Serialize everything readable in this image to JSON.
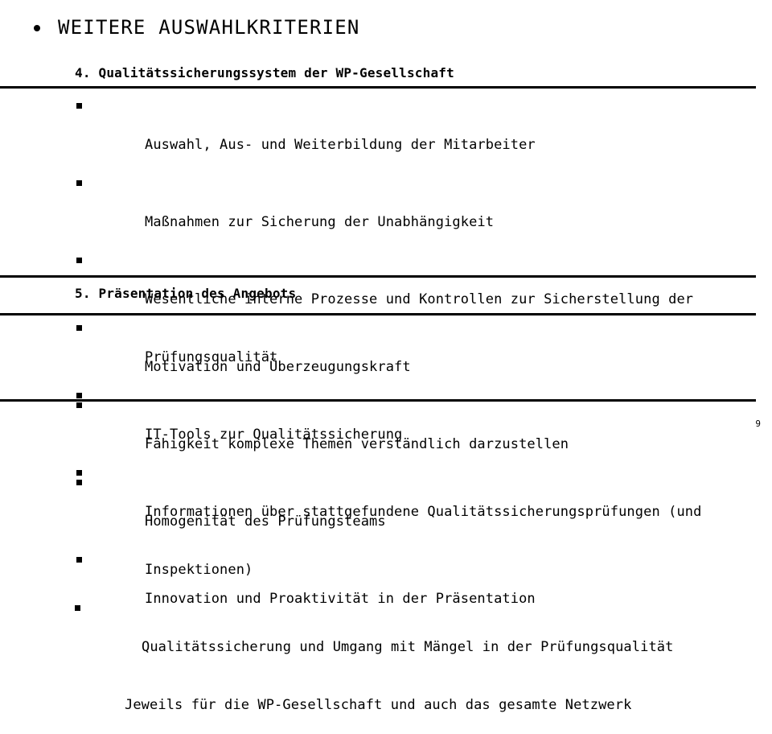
{
  "slide": {
    "title": "WEITERE AUSWAHLKRITERIEN",
    "title_bullet_icon": "bullet-dot-icon",
    "page_number": "9",
    "text_color": "#000000",
    "background_color": "#ffffff",
    "rule_color": "#000000",
    "sections": [
      {
        "heading": "4. Qualitätssicherungssystem der WP-Gesellschaft",
        "bullet_icon": "square-bullet-icon",
        "items": [
          {
            "kind": "bullet",
            "text": "Auswahl, Aus- und Weiterbildung der Mitarbeiter"
          },
          {
            "kind": "bullet",
            "text": "Maßnahmen zur Sicherung der Unabhängigkeit"
          },
          {
            "kind": "bullet",
            "text": "Wesentliche interne Prozesse und Kontrollen zur Sicherstellung der"
          },
          {
            "kind": "continuation",
            "text": "Prüfungsqualität"
          },
          {
            "kind": "bullet",
            "text": "IT-Tools zur Qualitätssicherung"
          },
          {
            "kind": "bullet",
            "text": "Informationen über stattgefundene Qualitätssicherungsprüfungen (und"
          },
          {
            "kind": "continuation",
            "text": "Inspektionen)"
          },
          {
            "kind": "bullet-tight",
            "text": "Qualitätssicherung und Umgang mit Mängel in der Prüfungsqualität"
          },
          {
            "kind": "plain",
            "text": "Jeweils für die WP-Gesellschaft und auch das gesamte Netzwerk"
          }
        ]
      },
      {
        "heading": "5. Präsentation des Angebots",
        "bullet_icon": "square-bullet-icon",
        "items": [
          {
            "kind": "bullet",
            "text": "Motivation und Überzeugungskraft"
          },
          {
            "kind": "bullet",
            "text": "Fähigkeit komplexe Themen verständlich darzustellen"
          },
          {
            "kind": "bullet",
            "text": "Homogenität des Prüfungsteams"
          },
          {
            "kind": "bullet",
            "text": "Innovation und Proaktivität in der Präsentation"
          }
        ]
      }
    ]
  }
}
